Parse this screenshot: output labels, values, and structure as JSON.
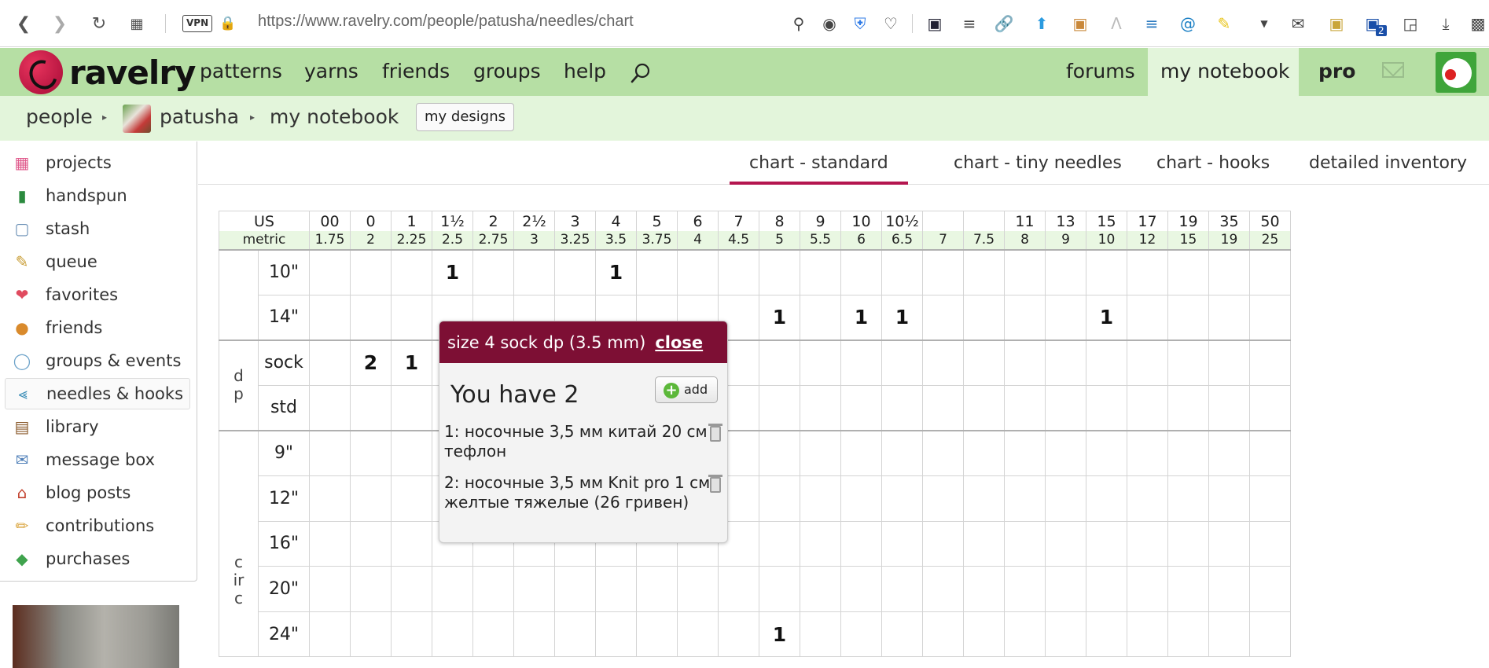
{
  "browser": {
    "vpn_label": "VPN",
    "url": "https://www.ravelry.com/people/patusha/needles/chart",
    "icons": [
      "back-icon",
      "forward-icon",
      "reload-icon",
      "grid-icon",
      "lock-icon",
      "zoom-icon",
      "camera-icon",
      "shield-icon",
      "heart-icon",
      "password-icon",
      "list-icon",
      "link-icon",
      "arrow-icon",
      "robot-icon",
      "font-icon",
      "code-icon",
      "at-icon",
      "pen-icon",
      "dropdown-icon",
      "mail-icon",
      "image-icon",
      "bitwarden-icon",
      "box-icon",
      "download-icon",
      "extension-icon"
    ],
    "extension_badge": "2"
  },
  "site_nav": {
    "logo": "ravelry",
    "items": [
      "patterns",
      "yarns",
      "friends",
      "groups",
      "help"
    ],
    "right_items": [
      "forums",
      "my notebook",
      "pro"
    ]
  },
  "breadcrumb": {
    "people": "people",
    "user": "patusha",
    "notebook": "my notebook",
    "my_designs": "my designs"
  },
  "sidebar": {
    "items": [
      {
        "label": "projects",
        "icon": "projects-icon"
      },
      {
        "label": "handspun",
        "icon": "spool-icon"
      },
      {
        "label": "stash",
        "icon": "basket-icon"
      },
      {
        "label": "queue",
        "icon": "notepad-icon"
      },
      {
        "label": "favorites",
        "icon": "heart-icon"
      },
      {
        "label": "friends",
        "icon": "people-icon"
      },
      {
        "label": "groups & events",
        "icon": "chat-bubbles-icon"
      },
      {
        "label": "needles & hooks",
        "icon": "needles-icon"
      },
      {
        "label": "library",
        "icon": "bookshelf-icon"
      },
      {
        "label": "message box",
        "icon": "envelope-icon"
      },
      {
        "label": "blog posts",
        "icon": "house-icon"
      },
      {
        "label": "contributions",
        "icon": "pencil-icon"
      },
      {
        "label": "purchases",
        "icon": "price-tag-icon"
      }
    ]
  },
  "tabs": [
    "chart - standard",
    "chart - tiny needles",
    "chart - hooks",
    "detailed inventory"
  ],
  "chart": {
    "us_label": "US",
    "metric_label": "metric",
    "us_sizes": [
      "00",
      "0",
      "1",
      "1½",
      "2",
      "2½",
      "3",
      "4",
      "5",
      "6",
      "7",
      "8",
      "9",
      "10",
      "10½",
      "",
      "",
      "11",
      "13",
      "15",
      "17",
      "19",
      "35",
      "50"
    ],
    "metric_sizes": [
      "1.75",
      "2",
      "2.25",
      "2.5",
      "2.75",
      "3",
      "3.25",
      "3.5",
      "3.75",
      "4",
      "4.5",
      "5",
      "5.5",
      "6",
      "6.5",
      "7",
      "7.5",
      "8",
      "9",
      "10",
      "12",
      "15",
      "19",
      "25"
    ],
    "groups": [
      {
        "label": "",
        "rows": [
          {
            "len": "10\"",
            "cells": [
              "",
              "",
              "",
              "1",
              "",
              "",
              "",
              "1",
              "",
              "",
              "",
              "",
              "",
              "",
              "",
              "",
              "",
              "",
              "",
              "",
              "",
              "",
              "",
              ""
            ]
          },
          {
            "len": "14\"",
            "cells": [
              "",
              "",
              "",
              "",
              "",
              "",
              "",
              "",
              "",
              "",
              "",
              "1",
              "",
              "1",
              "1",
              "",
              "",
              "",
              "",
              "1",
              "",
              "",
              "",
              ""
            ]
          }
        ]
      },
      {
        "label": "dp",
        "rows": [
          {
            "len": "sock",
            "cells": [
              "",
              "2",
              "1",
              "",
              "",
              "",
              "",
              "",
              "",
              "",
              "",
              "",
              "",
              "",
              "",
              "",
              "",
              "",
              "",
              "",
              "",
              "",
              "",
              ""
            ]
          },
          {
            "len": "std",
            "cells": [
              "",
              "",
              "",
              "",
              "",
              "",
              "",
              "",
              "",
              "",
              "",
              "",
              "",
              "",
              "",
              "",
              "",
              "",
              "",
              "",
              "",
              "",
              "",
              ""
            ]
          }
        ]
      },
      {
        "label": "circ",
        "rows": [
          {
            "len": "9\"",
            "cells": [
              "",
              "",
              "",
              "",
              "",
              "",
              "",
              "",
              "",
              "",
              "",
              "",
              "",
              "",
              "",
              "",
              "",
              "",
              "",
              "",
              "",
              "",
              "",
              ""
            ]
          },
          {
            "len": "12\"",
            "cells": [
              "",
              "",
              "",
              "",
              "",
              "",
              "",
              "",
              "",
              "",
              "",
              "",
              "",
              "",
              "",
              "",
              "",
              "",
              "",
              "",
              "",
              "",
              "",
              ""
            ]
          },
          {
            "len": "16\"",
            "cells": [
              "",
              "",
              "",
              "",
              "",
              "",
              "",
              "",
              "",
              "",
              "",
              "",
              "",
              "",
              "",
              "",
              "",
              "",
              "",
              "",
              "",
              "",
              "",
              ""
            ]
          },
          {
            "len": "20\"",
            "cells": [
              "",
              "",
              "",
              "",
              "",
              "",
              "",
              "",
              "",
              "",
              "",
              "",
              "",
              "",
              "",
              "",
              "",
              "",
              "",
              "",
              "",
              "",
              "",
              ""
            ]
          },
          {
            "len": "24\"",
            "cells": [
              "",
              "",
              "",
              "",
              "",
              "",
              "",
              "",
              "",
              "",
              "",
              "1",
              "",
              "",
              "",
              "",
              "",
              "",
              "",
              "",
              "",
              "",
              "",
              ""
            ]
          }
        ]
      }
    ]
  },
  "popup": {
    "title": "size 4 sock dp (3.5 mm)",
    "close": "close",
    "have": "You have 2",
    "add": "add",
    "entries": [
      "1:  носочные 3,5 мм китай 20 см тефлон",
      "2:  носочные 3,5 мм Knit pro 1 см желтые тяжелые (26 гривен)"
    ]
  },
  "colors": {
    "nav_green": "#b6dfa4",
    "crumb_green": "#e3f5db",
    "popup_header": "#7d0f34",
    "active_tab_underline": "#b4164f"
  }
}
